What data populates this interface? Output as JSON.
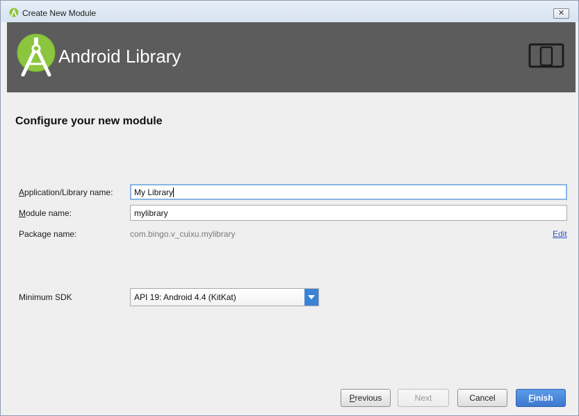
{
  "window": {
    "title": "Create New Module",
    "close_glyph": "✕"
  },
  "header": {
    "title": "Android Library",
    "icons": [
      "android-studio-logo-icon",
      "tablet-phone-icon"
    ]
  },
  "main": {
    "section_title": "Configure your new module",
    "fields": {
      "app_name": {
        "label_mnemonic": "A",
        "label_rest": "pplication/Library name:",
        "value": "My Library"
      },
      "module_name": {
        "label_mnemonic": "M",
        "label_rest": "odule name:",
        "value": "mylibrary"
      },
      "package_name": {
        "label": "Package name:",
        "value": "com.bingo.v_cuixu.mylibrary",
        "edit_label": "Edit"
      },
      "min_sdk": {
        "label": "Minimum SDK",
        "selected": "API 19: Android 4.4 (KitKat)"
      }
    }
  },
  "buttons": {
    "previous": {
      "mnemonic": "P",
      "rest": "revious"
    },
    "next": "Next",
    "cancel": "Cancel",
    "finish": {
      "mnemonic": "F",
      "rest": "inish"
    }
  },
  "colors": {
    "header_bg": "#5c5c5c",
    "accent": "#3c78cf",
    "android_green": "#8cc63f",
    "link": "#2b54c7"
  }
}
